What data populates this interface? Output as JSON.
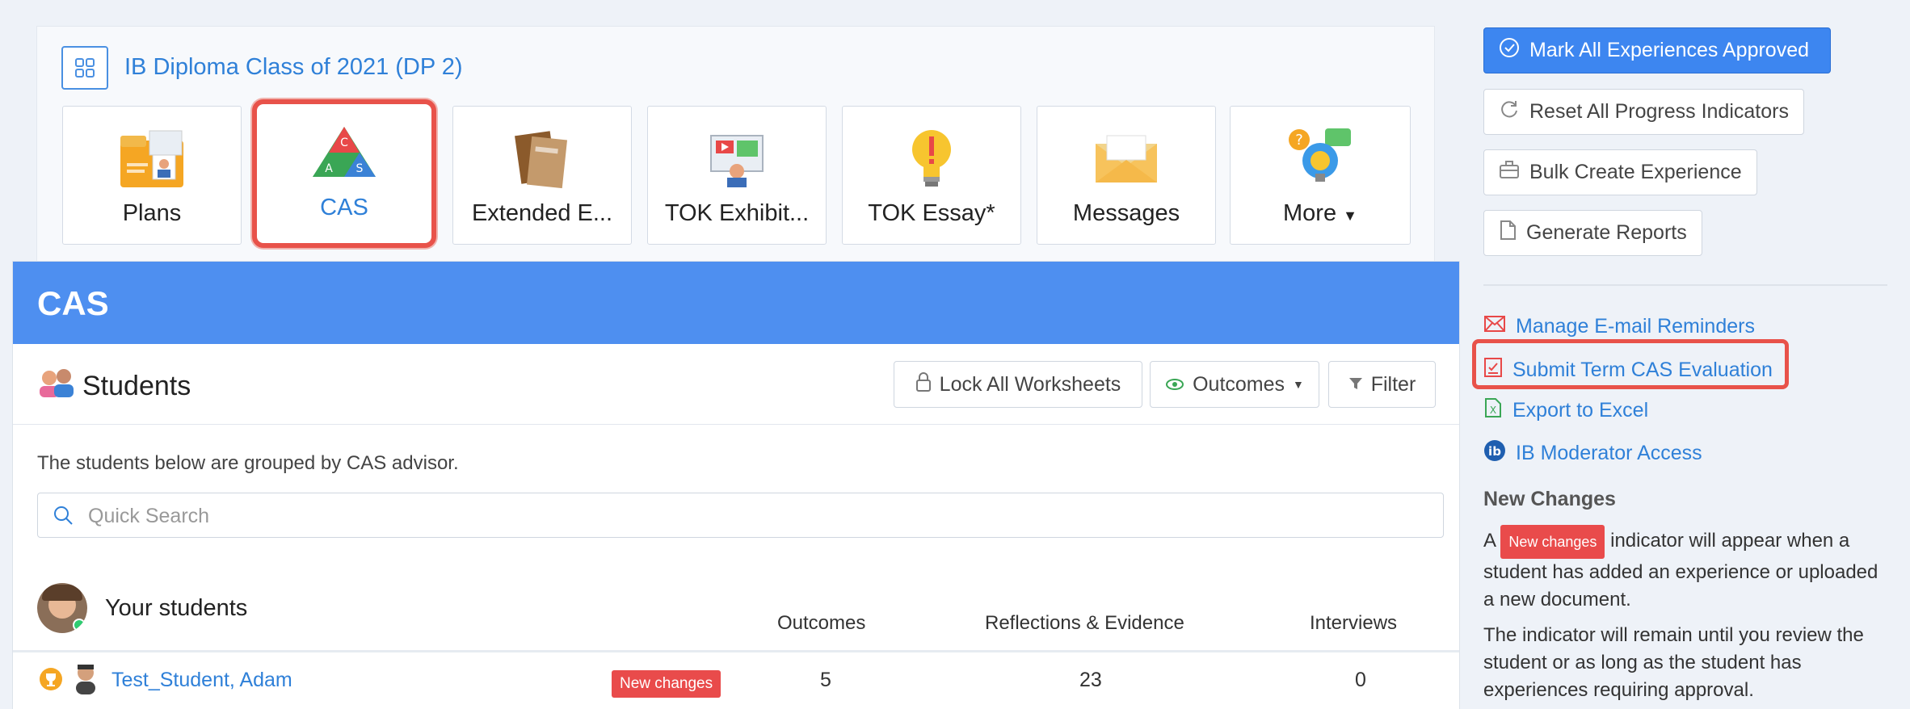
{
  "class_title": "IB Diploma Class of 2021 (DP 2)",
  "tiles": [
    {
      "label": "Plans",
      "icon": "folder-icon"
    },
    {
      "label": "CAS",
      "icon": "cas-triangle-icon"
    },
    {
      "label": "Extended E...",
      "icon": "books-icon"
    },
    {
      "label": "TOK Exhibit...",
      "icon": "presentation-icon"
    },
    {
      "label": "TOK Essay*",
      "icon": "lightbulb-icon"
    },
    {
      "label": "Messages",
      "icon": "envelope-icon"
    },
    {
      "label": "More",
      "icon": "help-bulb-icon"
    }
  ],
  "cas_header": "CAS",
  "students_title": "Students",
  "toolbar": {
    "lock_label": "Lock All Worksheets",
    "outcomes_label": "Outcomes",
    "filter_label": "Filter"
  },
  "grouped_text": "The students below are grouped by CAS advisor.",
  "search": {
    "placeholder": "Quick Search",
    "value": ""
  },
  "your_students": "Your students",
  "columns": {
    "outcomes": "Outcomes",
    "reflections": "Reflections & Evidence",
    "interviews": "Interviews"
  },
  "students": [
    {
      "name": "Test_Student, Adam",
      "badge": "New changes",
      "outcomes": "5",
      "reflections": "23",
      "interviews": "0"
    }
  ],
  "sidebar": {
    "mark_all": "Mark All Experiences Approved",
    "reset": "Reset All Progress Indicators",
    "bulk_create": "Bulk Create Experience",
    "generate_reports": "Generate Reports",
    "links": [
      {
        "label": "Manage E-mail Reminders",
        "icon": "envelope-icon"
      },
      {
        "label": "Submit Term CAS Evaluation",
        "icon": "checklist-icon"
      },
      {
        "label": "Export to Excel",
        "icon": "excel-icon"
      },
      {
        "label": "IB Moderator Access",
        "icon": "ib-logo-icon"
      }
    ],
    "new_changes_heading": "New Changes",
    "para1_prefix": "A",
    "para1_badge": "New changes",
    "para1_suffix": "indicator will appear when a student has added an experience or uploaded a new document.",
    "para2": "The indicator will remain until you review the student or as long as the student has experiences requiring approval."
  },
  "colors": {
    "accent": "#4e8ff0",
    "link": "#2f80d8",
    "badge": "#e94b4b",
    "highlight": "#e8524a"
  }
}
